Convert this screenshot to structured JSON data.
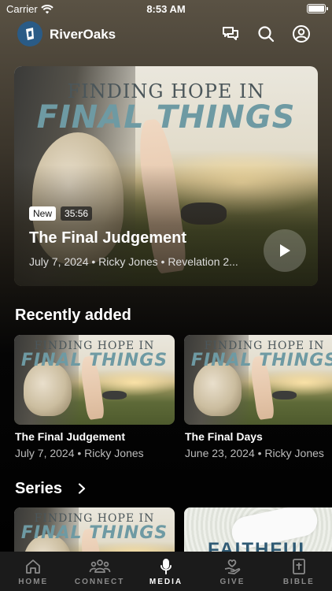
{
  "status_bar": {
    "carrier": "Carrier",
    "time": "8:53 AM"
  },
  "header": {
    "app_name": "RiverOaks"
  },
  "artwork": {
    "line1": "FINDING HOPE IN",
    "line2": "FINAL THINGS"
  },
  "hero": {
    "badge_new": "New",
    "duration": "35:56",
    "title": "The Final Judgement",
    "meta": "July 7, 2024 • Ricky Jones • Revelation 2..."
  },
  "recently_added": {
    "title": "Recently added",
    "items": [
      {
        "title": "The Final Judgement",
        "meta": "July 7, 2024 • Ricky Jones"
      },
      {
        "title": "The Final Days",
        "meta": "June 23, 2024 • Ricky Jones"
      }
    ]
  },
  "series": {
    "title": "Series",
    "second_card_text": "FAITHFUL"
  },
  "tabs": [
    {
      "label": "HOME",
      "icon": "home-icon",
      "active": false
    },
    {
      "label": "CONNECT",
      "icon": "people-icon",
      "active": false
    },
    {
      "label": "MEDIA",
      "icon": "microphone-icon",
      "active": true
    },
    {
      "label": "GIVE",
      "icon": "give-icon",
      "active": false
    },
    {
      "label": "BIBLE",
      "icon": "bible-icon",
      "active": false
    }
  ],
  "colors": {
    "tab_bar": "#1b1b1b",
    "logo_blue": "#2a5b86",
    "art_title_teal": "#6e9aa3"
  }
}
